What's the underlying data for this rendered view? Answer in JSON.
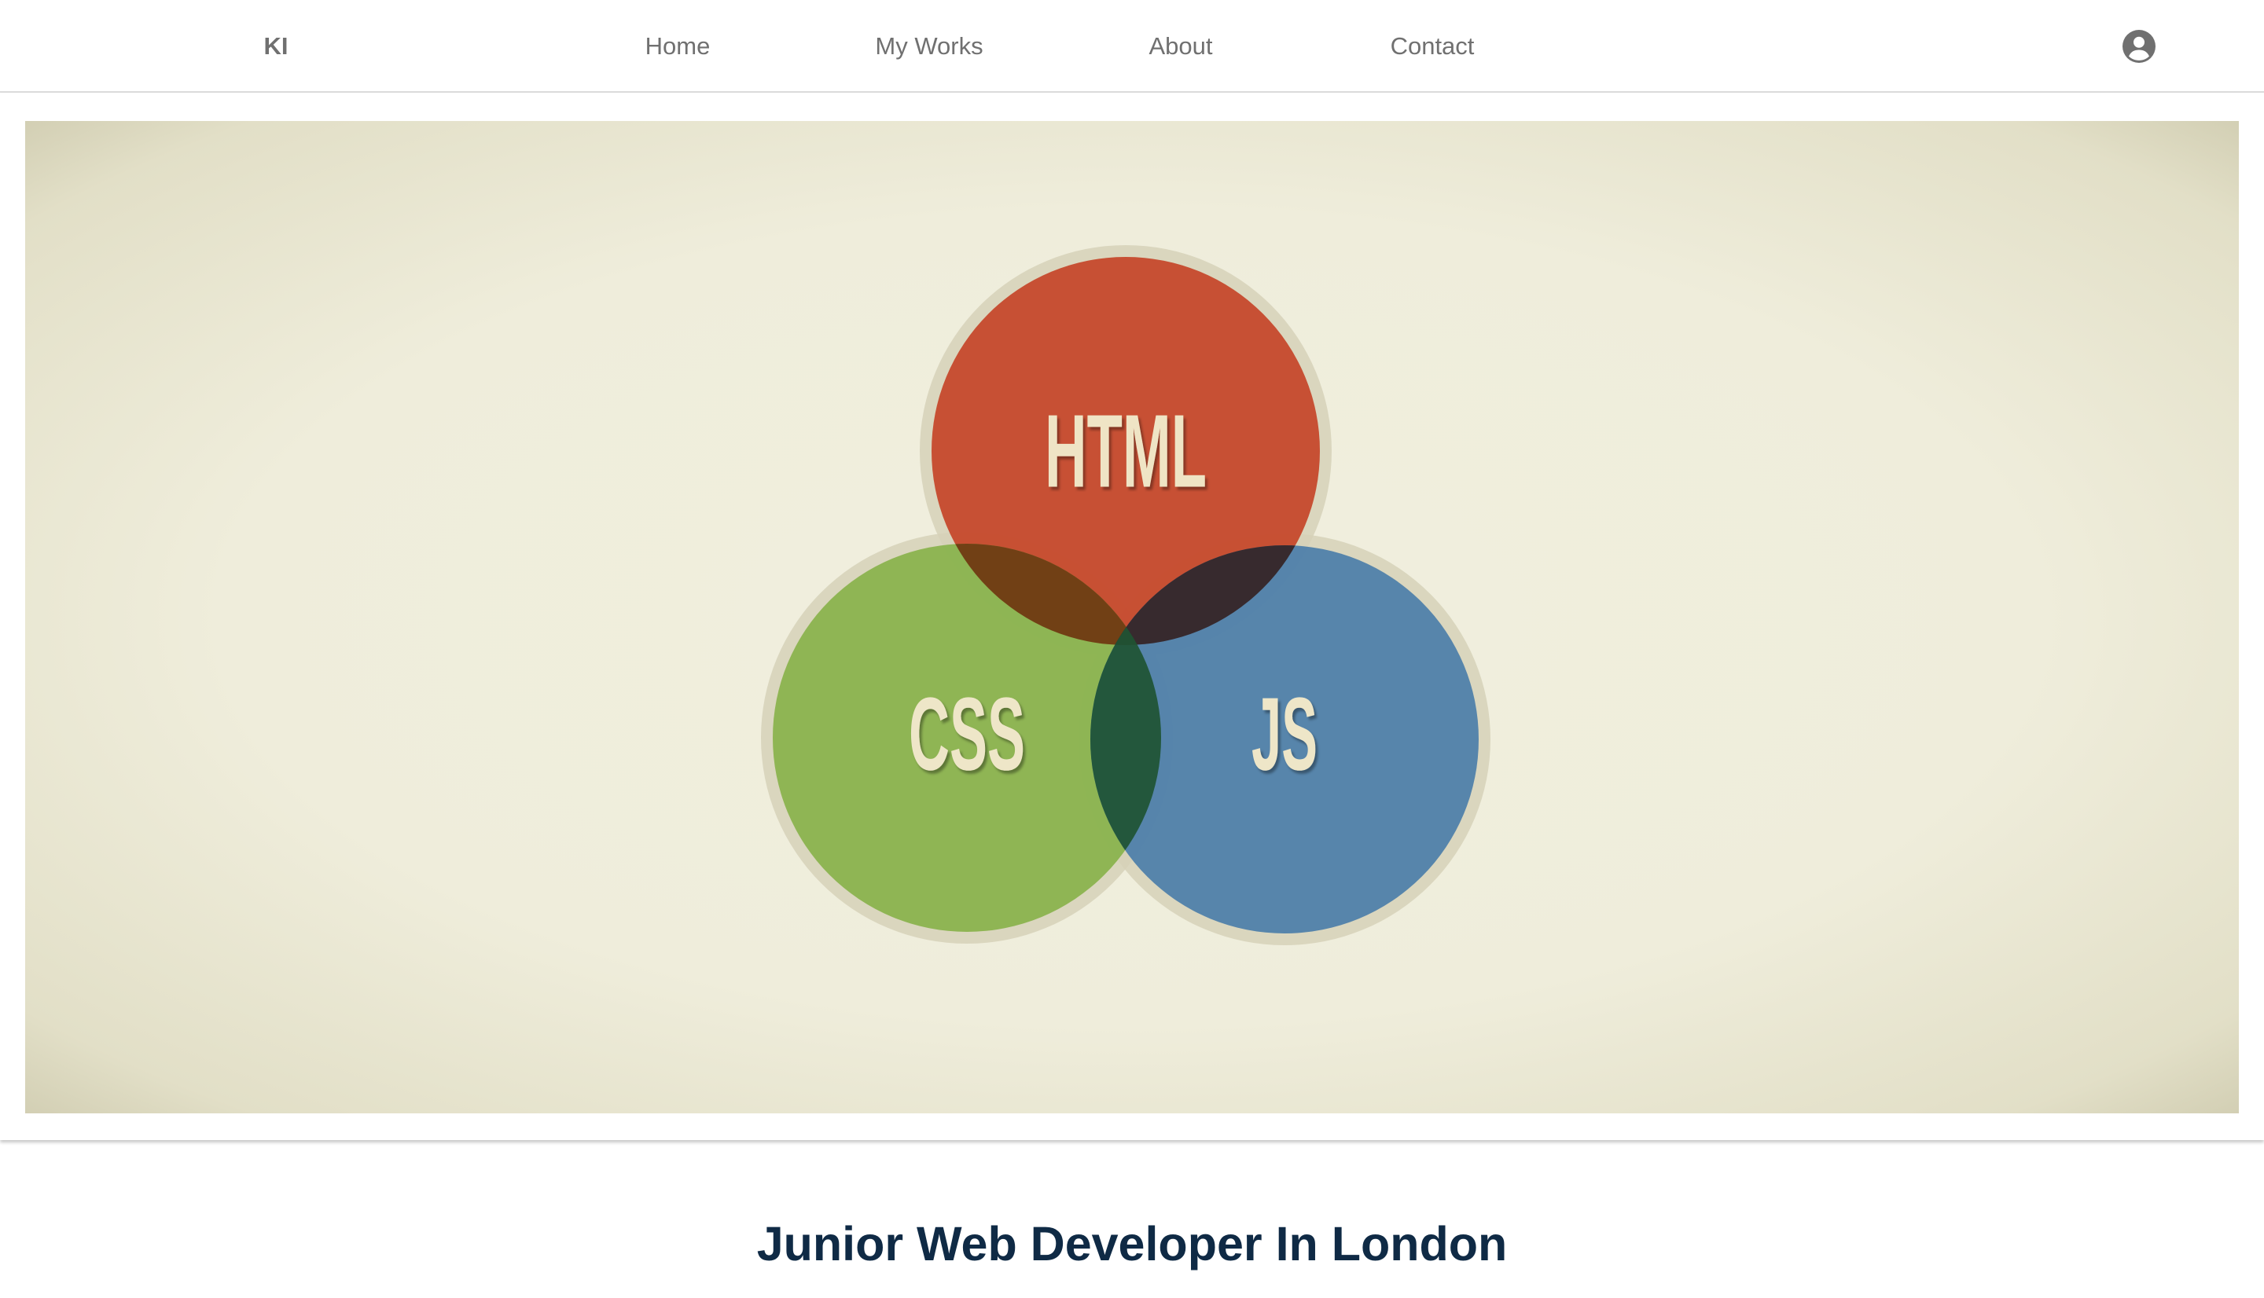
{
  "navbar": {
    "brand": "KI",
    "links": [
      {
        "label": "Home"
      },
      {
        "label": "My Works"
      },
      {
        "label": "About"
      },
      {
        "label": "Contact"
      }
    ],
    "account_icon": "account-circle-icon"
  },
  "hero": {
    "image_labels": {
      "top": "HTML",
      "left": "CSS",
      "right": "JS"
    },
    "colors": {
      "background": "#efeedc",
      "html_circle": "#c64a2e",
      "css_circle": "#84b046",
      "js_circle": "#3f77a8"
    }
  },
  "main": {
    "tagline": "Junior Web Developer In London"
  }
}
